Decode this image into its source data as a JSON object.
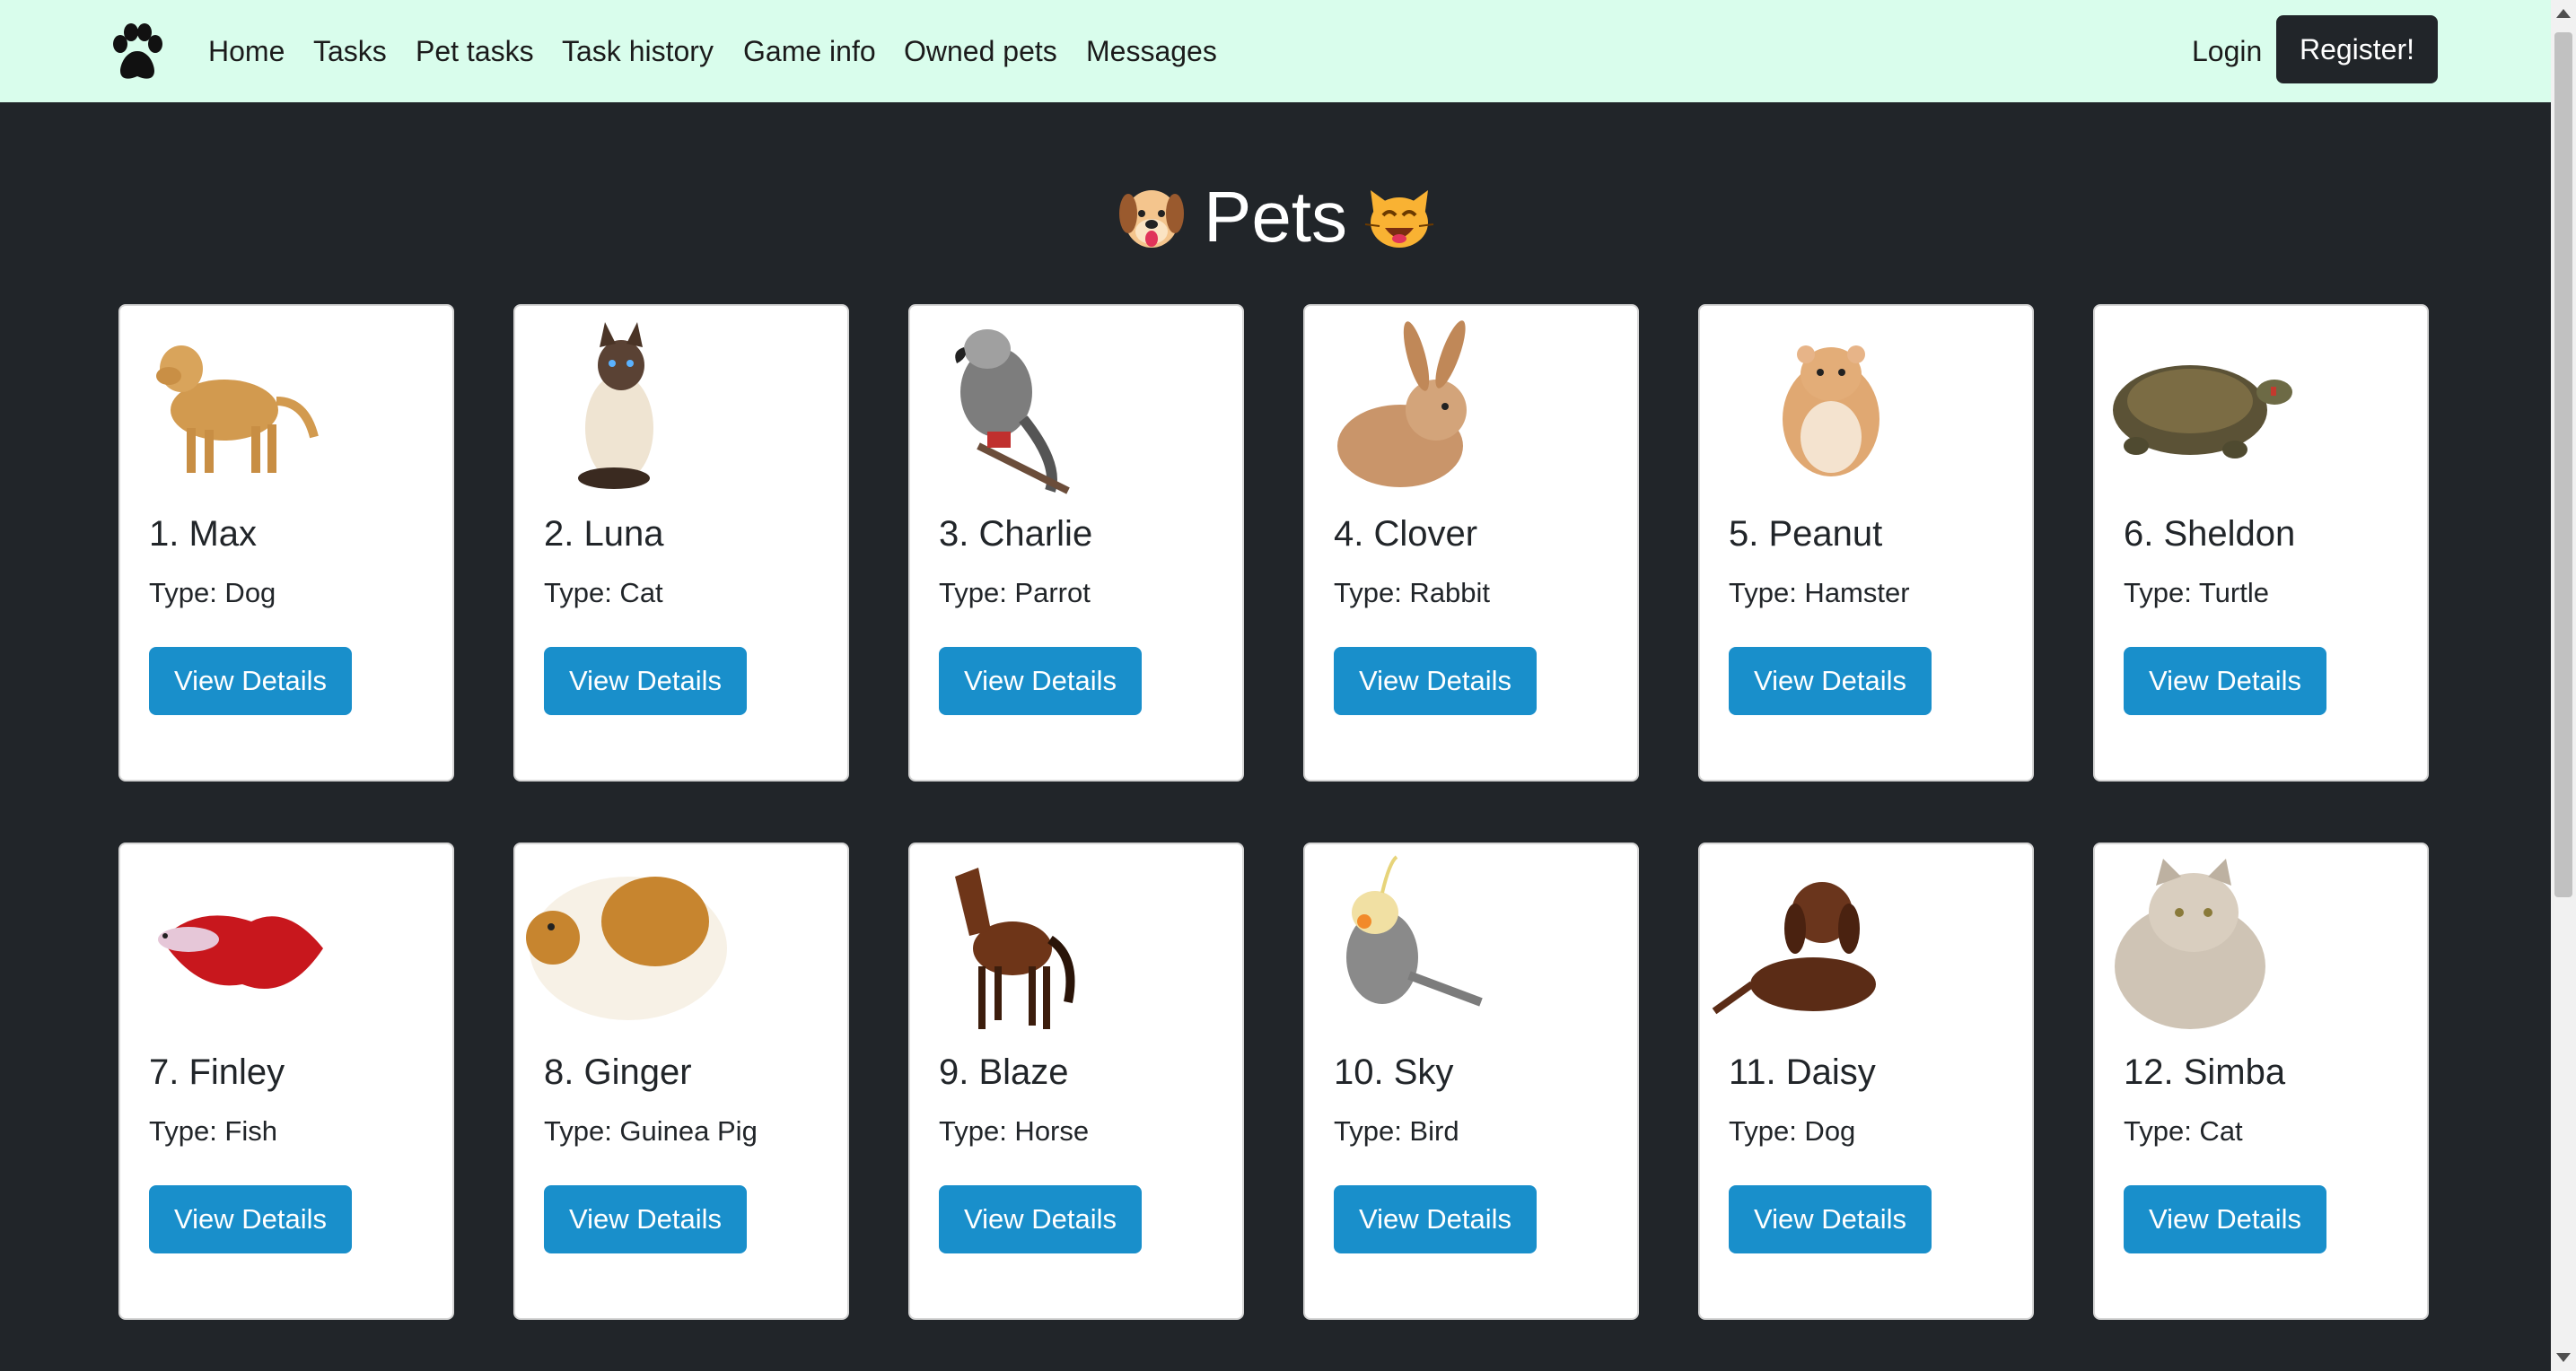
{
  "nav": {
    "links": [
      "Home",
      "Tasks",
      "Pet tasks",
      "Task history",
      "Game info",
      "Owned pets",
      "Messages"
    ],
    "login": "Login",
    "register": "Register!",
    "logo_icon": "paw-icon"
  },
  "page": {
    "title": "Pets",
    "left_emoji": "dog-face-emoji",
    "right_emoji": "cat-face-emoji"
  },
  "pets": [
    {
      "name": "1. Max",
      "type": "Type: Dog",
      "button": "View Details",
      "image": "golden-retriever"
    },
    {
      "name": "2. Luna",
      "type": "Type: Cat",
      "button": "View Details",
      "image": "siamese-cat"
    },
    {
      "name": "3. Charlie",
      "type": "Type: Parrot",
      "button": "View Details",
      "image": "grey-parrot"
    },
    {
      "name": "4. Clover",
      "type": "Type: Rabbit",
      "button": "View Details",
      "image": "brown-rabbit"
    },
    {
      "name": "5. Peanut",
      "type": "Type: Hamster",
      "button": "View Details",
      "image": "hamster"
    },
    {
      "name": "6. Sheldon",
      "type": "Type: Turtle",
      "button": "View Details",
      "image": "turtle"
    },
    {
      "name": "7. Finley",
      "type": "Type: Fish",
      "button": "View Details",
      "image": "betta-fish"
    },
    {
      "name": "8. Ginger",
      "type": "Type: Guinea Pig",
      "button": "View Details",
      "image": "guinea-pig"
    },
    {
      "name": "9. Blaze",
      "type": "Type: Horse",
      "button": "View Details",
      "image": "brown-horse"
    },
    {
      "name": "10. Sky",
      "type": "Type: Bird",
      "button": "View Details",
      "image": "cockatiel"
    },
    {
      "name": "11. Daisy",
      "type": "Type: Dog",
      "button": "View Details",
      "image": "dachshund"
    },
    {
      "name": "12. Simba",
      "type": "Type: Cat",
      "button": "View Details",
      "image": "persian-cat"
    }
  ],
  "colors": {
    "navbar_bg": "#d9fdec",
    "page_bg": "#212529",
    "button_bg": "#198fcb",
    "register_bg": "#212529"
  }
}
